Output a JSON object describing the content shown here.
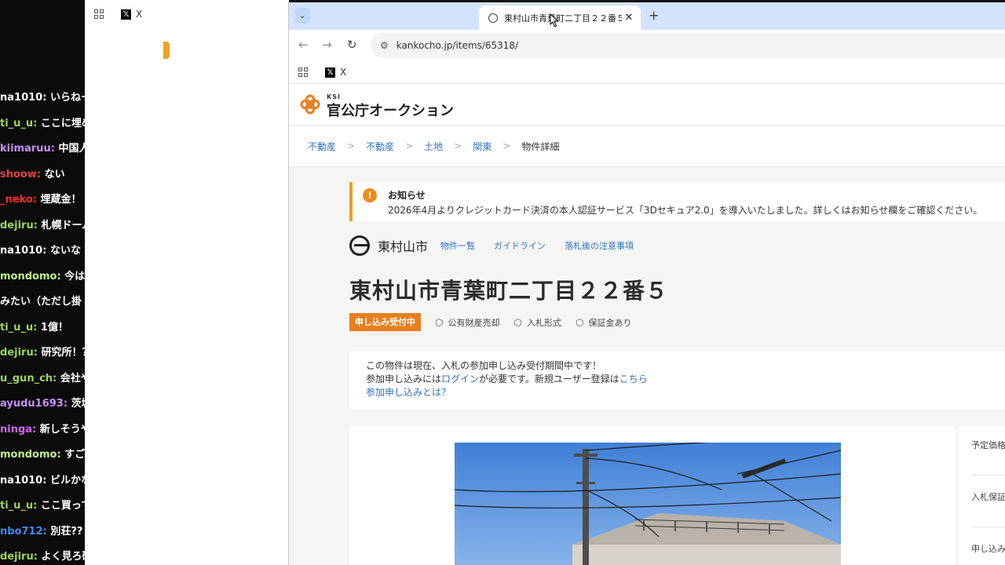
{
  "chat": {
    "lines": [
      {
        "user": "na1010",
        "text": "いらねー",
        "color": "#ffffff"
      },
      {
        "user": "ti_u_u",
        "text": "ここに埋め",
        "color": "#9bd45a"
      },
      {
        "user": "kiimaruu",
        "text": "中国人",
        "color": "#c78ef5"
      },
      {
        "user": "shoow",
        "text": "ない",
        "color": "#e8423b"
      },
      {
        "user": "_neko",
        "text": "埋蔵金！",
        "color": "#ff2a2a"
      },
      {
        "user": "dejiru",
        "text": "札幌ドーム",
        "color": "#9bd45a"
      },
      {
        "user": "na1010",
        "text": "ないな",
        "color": "#ffffff"
      },
      {
        "user": "mondomo",
        "text": "今はこ",
        "color": "#c0f28a"
      },
      {
        "user": "",
        "text": "みたい（ただし掛",
        "color": "#ffffff"
      },
      {
        "user": "ti_u_u",
        "text": "1億！",
        "color": "#9bd45a"
      },
      {
        "user": "dejiru",
        "text": "研究所！？",
        "color": "#9bd45a"
      },
      {
        "user": "u_gun_ch",
        "text": "会社や",
        "color": "#9bd45a"
      },
      {
        "user": "ayudu1693",
        "text": "茨城",
        "color": "#c78ef5"
      },
      {
        "user": "ninga",
        "text": "新しそうや",
        "color": "#d264f0"
      },
      {
        "user": "mondomo",
        "text": "すごー",
        "color": "#c0f28a"
      },
      {
        "user": "na1010",
        "text": "ビルかな",
        "color": "#ffffff"
      },
      {
        "user": "ti_u_u",
        "text": "ここ買って",
        "color": "#9bd45a"
      },
      {
        "user": "nbo712",
        "text": "別荘??",
        "color": "#3d8cf0"
      },
      {
        "user": "dejiru",
        "text": "よく見ろ研",
        "color": "#9bd45a"
      }
    ]
  },
  "back_window": {
    "bookmark_x": "X"
  },
  "browser": {
    "tab_title": "東村山市青葉町二丁目２２番５",
    "url": "kankocho.jp/items/65318/",
    "bookmark_x": "X",
    "icons": {
      "tab_search": "chevron-down-icon",
      "back": "back-arrow-icon",
      "forward": "forward-arrow-icon",
      "reload": "reload-icon",
      "new_tab": "plus-icon"
    }
  },
  "site": {
    "ksi": "KSI",
    "brand": "官公庁オークション",
    "brand_color": "#e97e1d",
    "link_color": "#2b73c4",
    "breadcrumb": [
      {
        "label": "不動産",
        "link": true
      },
      {
        "label": "不動産",
        "link": true
      },
      {
        "label": "土地",
        "link": true
      },
      {
        "label": "関東",
        "link": true
      },
      {
        "label": "物件詳細",
        "link": false
      }
    ],
    "notice": {
      "title": "お知らせ",
      "body": "2026年4月よりクレジットカード決済の本人認証サービス「3Dセキュア2.0」を導入いたしました。詳しくはお知らせ欄をご確認ください。"
    },
    "org": {
      "name": "東村山市",
      "links": [
        "物件一覧",
        "ガイドライン",
        "落札後の注意事項"
      ]
    },
    "item": {
      "title": "東村山市青葉町二丁目２２番５",
      "status": "申し込み受付中",
      "tags": [
        "公有財産売却",
        "入札形式",
        "保証金あり"
      ]
    },
    "info": {
      "line1": "この物件は現在、入札の参加申し込み受付期間中です！",
      "line2_prefix": "参加申し込みには",
      "line2_login": "ログイン",
      "line2_mid": "が必要です。新規ユーザー登録は",
      "line2_link": "こちら",
      "line3": "参加申し込みとは？"
    },
    "side_panel": {
      "rows": [
        "予定価格",
        "入札保証",
        "申し込み"
      ]
    }
  }
}
